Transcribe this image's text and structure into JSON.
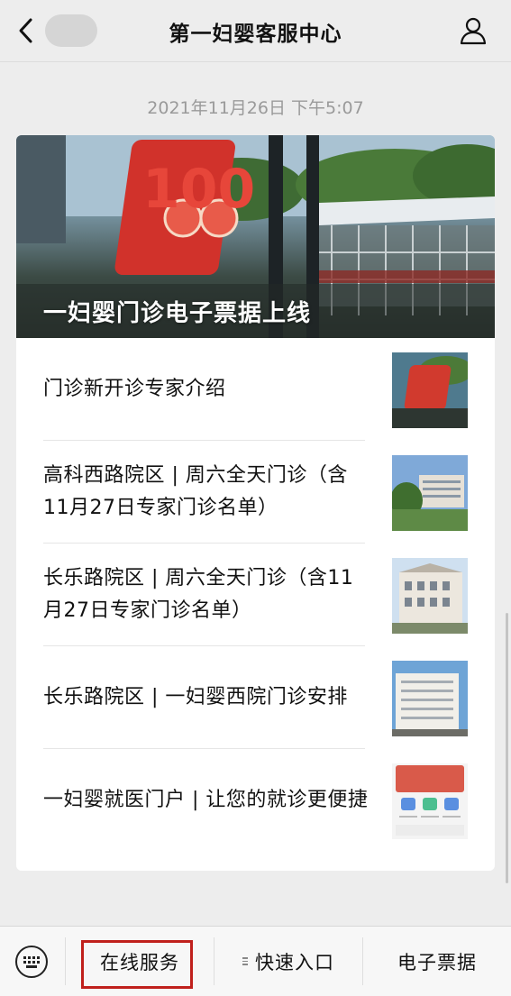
{
  "header": {
    "title": "第一妇婴客服中心",
    "back_icon": "chevron-left-icon",
    "profile_icon": "user-icon"
  },
  "timestamp": "2021年11月26日 下午5:07",
  "hero": {
    "title": "一妇婴门诊电子票据上线",
    "badge_text": "100"
  },
  "articles": [
    {
      "title": "门诊新开诊专家介绍",
      "thumb": "red-sculpture"
    },
    {
      "title": "高科西路院区 | 周六全天门诊（含11月27日专家门诊名单）",
      "thumb": "building-modern"
    },
    {
      "title": "长乐路院区 | 周六全天门诊（含11月27日专家门诊名单）",
      "thumb": "building-classic"
    },
    {
      "title": "长乐路院区 | 一妇婴西院门诊安排",
      "thumb": "building-white"
    },
    {
      "title": "一妇婴就医门户 | 让您的就诊更便捷",
      "thumb": "app-portal"
    }
  ],
  "bottom_menu": {
    "keyboard_icon": "keyboard-icon",
    "items": [
      "在线服务",
      "快速入口",
      "电子票据"
    ],
    "highlight_color": "#c0201c"
  }
}
